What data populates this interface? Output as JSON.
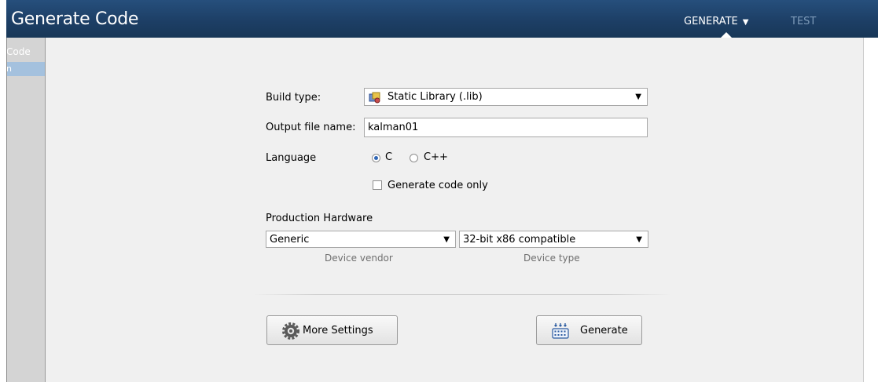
{
  "title": "Generate Code",
  "tabs": [
    {
      "label": "GENERATE",
      "active": true
    },
    {
      "label": "TEST",
      "active": false
    }
  ],
  "left_strip": {
    "item1": "Code",
    "item2": "n"
  },
  "form": {
    "build_type_label": "Build type:",
    "build_type_value": "Static Library (.lib)",
    "output_label": "Output file name:",
    "output_value": "kalman01",
    "language_label": "Language",
    "lang_c": "C",
    "lang_cpp": "C++",
    "language_selected": "C",
    "gen_code_only_label": "Generate code only",
    "gen_code_only_checked": false,
    "production_hardware_label": "Production Hardware",
    "device_vendor_value": "Generic",
    "device_vendor_caption": "Device vendor",
    "device_type_value": "32-bit x86 compatible",
    "device_type_caption": "Device type"
  },
  "buttons": {
    "more_settings": "More Settings",
    "generate": "Generate"
  },
  "colors": {
    "titlebar": "#1d3f66",
    "panel": "#f0f0f0",
    "tab_inactive": "#7d9ab8",
    "radio_selected": "#2f66b5"
  },
  "icons": {
    "build_type": "library-icon",
    "more_settings": "gear-icon",
    "generate": "generate-code-icon"
  }
}
